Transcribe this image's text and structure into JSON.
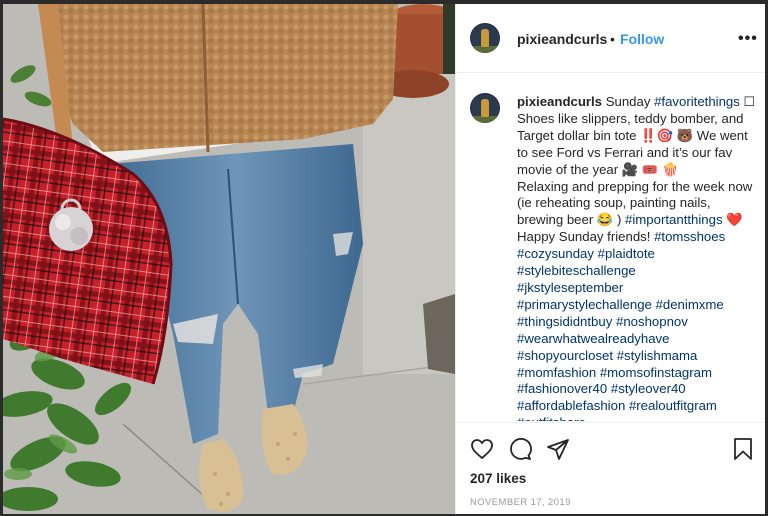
{
  "post": {
    "username": "pixieandcurls",
    "separator": "•",
    "follow_label": "Follow",
    "more_label": "•••",
    "caption": {
      "username": "pixieandcurls",
      "segments": [
        {
          "t": " Sunday "
        },
        {
          "t": "#favoritethings",
          "tag": true
        },
        {
          "t": " ☐ Shoes like slippers, teddy bomber, and Target dollar bin tote ‼️🎯 🐻  We went to see Ford vs Ferrari and it’s our fav movie of the year 🎥 🎟️ 🍿 "
        },
        {
          "br": true
        },
        {
          "t": "Relaxing and prepping for the week now (ie reheating soup, painting nails, brewing beer 😂 ) "
        },
        {
          "t": "#importantthings",
          "tag": true
        },
        {
          "t": " ❤️ "
        },
        {
          "br": true
        },
        {
          "t": "Happy Sunday friends! "
        },
        {
          "t": "#tomsshoes",
          "tag": true
        },
        {
          "br": true
        },
        {
          "t": "#cozysunday",
          "tag": true
        },
        {
          "t": " "
        },
        {
          "t": "#plaidtote",
          "tag": true
        },
        {
          "br": true
        },
        {
          "t": "#stylebiteschallenge",
          "tag": true
        },
        {
          "br": true
        },
        {
          "t": "#jkstyleseptember",
          "tag": true
        },
        {
          "br": true
        },
        {
          "t": "#primarystylechallenge",
          "tag": true
        },
        {
          "t": " "
        },
        {
          "t": "#denimxme",
          "tag": true
        },
        {
          "br": true
        },
        {
          "t": "#thingsididntbuy",
          "tag": true
        },
        {
          "t": " "
        },
        {
          "t": "#noshopnov",
          "tag": true
        },
        {
          "br": true
        },
        {
          "t": "#wearwhatwealreadyhave",
          "tag": true
        },
        {
          "br": true
        },
        {
          "t": "#shopyourcloset",
          "tag": true
        },
        {
          "t": " "
        },
        {
          "t": "#stylishmama",
          "tag": true
        },
        {
          "br": true
        },
        {
          "t": "#momfashion",
          "tag": true
        },
        {
          "t": " "
        },
        {
          "t": "#momsofinstagram",
          "tag": true
        },
        {
          "br": true
        },
        {
          "t": "#fashionover40",
          "tag": true
        },
        {
          "t": " "
        },
        {
          "t": "#styleover40",
          "tag": true
        },
        {
          "br": true
        },
        {
          "t": "#affordablefashion",
          "tag": true
        },
        {
          "t": " "
        },
        {
          "t": "#realoutfitgram",
          "tag": true
        },
        {
          "br": true
        },
        {
          "t": "#outfitshare",
          "tag": true
        }
      ]
    },
    "likes_label": "207 likes",
    "date_label": "NOVEMBER 17, 2019",
    "icons": [
      "heart-icon",
      "comment-icon",
      "share-icon",
      "bookmark-icon"
    ],
    "colors": {
      "link": "#3897f0",
      "hashtag": "#003569",
      "text": "#262626",
      "muted": "#999999",
      "border": "#efefef"
    }
  }
}
